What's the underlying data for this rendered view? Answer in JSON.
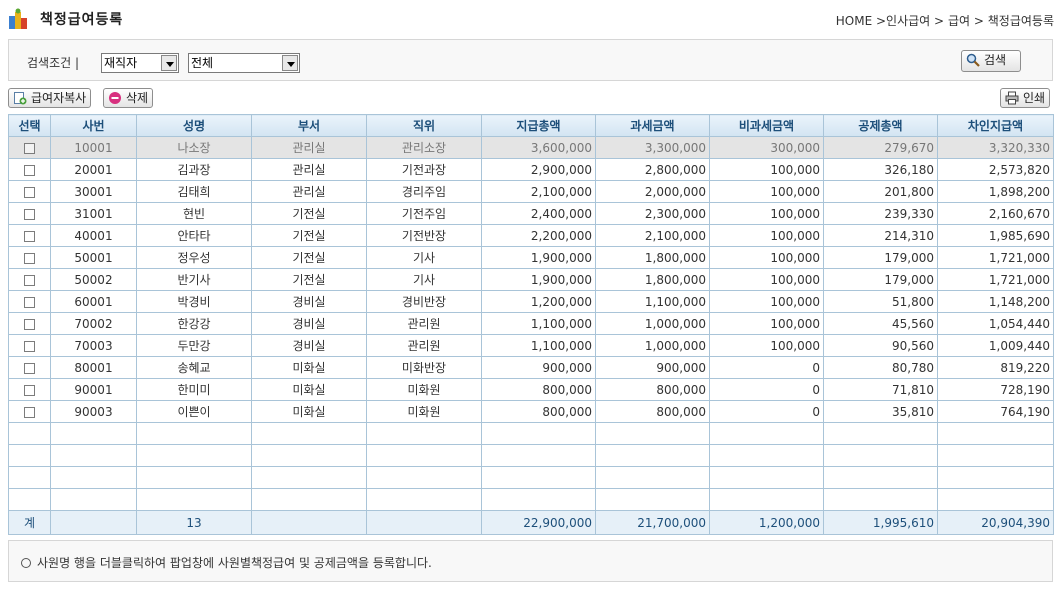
{
  "page": {
    "title": "책정급여등록",
    "breadcrumb": [
      "HOME",
      ">인사급여",
      ">",
      "급여",
      ">",
      "책정급여등록"
    ]
  },
  "search": {
    "label": "검색조건 |",
    "status_select": "재직자",
    "dept_select": "전체",
    "search_label": "검색"
  },
  "toolbar": {
    "copy_label": "급여자복사",
    "delete_label": "삭제",
    "print_label": "인쇄"
  },
  "table": {
    "headers": [
      "선택",
      "사번",
      "성명",
      "부서",
      "직위",
      "지급총액",
      "과세금액",
      "비과세금액",
      "공제총액",
      "차인지급액"
    ],
    "rows": [
      [
        "10001",
        "나소장",
        "관리실",
        "관리소장",
        "3,600,000",
        "3,300,000",
        "300,000",
        "279,670",
        "3,320,330"
      ],
      [
        "20001",
        "김과장",
        "관리실",
        "기전과장",
        "2,900,000",
        "2,800,000",
        "100,000",
        "326,180",
        "2,573,820"
      ],
      [
        "30001",
        "김태희",
        "관리실",
        "경리주임",
        "2,100,000",
        "2,000,000",
        "100,000",
        "201,800",
        "1,898,200"
      ],
      [
        "31001",
        "현빈",
        "기전실",
        "기전주임",
        "2,400,000",
        "2,300,000",
        "100,000",
        "239,330",
        "2,160,670"
      ],
      [
        "40001",
        "안타타",
        "기전실",
        "기전반장",
        "2,200,000",
        "2,100,000",
        "100,000",
        "214,310",
        "1,985,690"
      ],
      [
        "50001",
        "정우성",
        "기전실",
        "기사",
        "1,900,000",
        "1,800,000",
        "100,000",
        "179,000",
        "1,721,000"
      ],
      [
        "50002",
        "반기사",
        "기전실",
        "기사",
        "1,900,000",
        "1,800,000",
        "100,000",
        "179,000",
        "1,721,000"
      ],
      [
        "60001",
        "박경비",
        "경비실",
        "경비반장",
        "1,200,000",
        "1,100,000",
        "100,000",
        "51,800",
        "1,148,200"
      ],
      [
        "70002",
        "한강강",
        "경비실",
        "관리원",
        "1,100,000",
        "1,000,000",
        "100,000",
        "45,560",
        "1,054,440"
      ],
      [
        "70003",
        "두만강",
        "경비실",
        "관리원",
        "1,100,000",
        "1,000,000",
        "100,000",
        "90,560",
        "1,009,440"
      ],
      [
        "80001",
        "송혜교",
        "미화실",
        "미화반장",
        "900,000",
        "900,000",
        "0",
        "80,780",
        "819,220"
      ],
      [
        "90001",
        "한미미",
        "미화실",
        "미화원",
        "800,000",
        "800,000",
        "0",
        "71,810",
        "728,190"
      ],
      [
        "90003",
        "이쁜이",
        "미화실",
        "미화원",
        "800,000",
        "800,000",
        "0",
        "35,810",
        "764,190"
      ]
    ],
    "footer": {
      "label": "계",
      "count": "13",
      "total_pay": "22,900,000",
      "taxable": "21,700,000",
      "non_taxable": "1,200,000",
      "deductions": "1,995,610",
      "net_pay": "20,904,390"
    }
  },
  "note": "사원명 행을 더블클릭하여 팝업창에 사원별책정급여 및 공제금액을 등록합니다.",
  "colors": {
    "header_text": "#1d4f7a",
    "grid_border": "#a9c4d8",
    "selected_row": "#e4e4e4"
  }
}
